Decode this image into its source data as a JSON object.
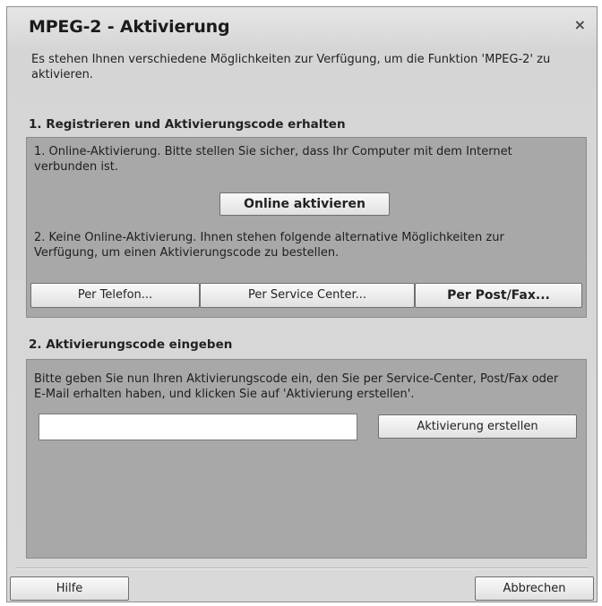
{
  "dialog": {
    "title": "MPEG-2 - Aktivierung",
    "close_glyph": "×",
    "intro": "Es stehen Ihnen verschiedene Möglichkeiten zur Verfügung, um die Funktion 'MPEG-2'  zu aktivieren."
  },
  "section1": {
    "heading": "1. Registrieren und Aktivierungscode erhalten",
    "online_text": "1. Online-Aktivierung. Bitte stellen Sie sicher, dass Ihr Computer mit dem Internet verbunden ist.",
    "online_button": "Online aktivieren",
    "offline_text": "2. Keine Online-Aktivierung. Ihnen stehen folgende alternative Möglichkeiten zur Verfügung, um einen Aktivierungscode zu bestellen.",
    "options": [
      "Per Telefon...",
      "Per Service Center...",
      "Per Post/Fax..."
    ]
  },
  "section2": {
    "heading": "2. Aktivierungscode eingeben",
    "text": "Bitte geben Sie nun Ihren Aktivierungscode ein, den Sie per Service-Center, Post/Fax oder E-Mail erhalten haben, und klicken Sie auf 'Aktivierung erstellen'.",
    "code_value": "",
    "create_button": "Aktivierung erstellen"
  },
  "footer": {
    "help_button": "Hilfe",
    "cancel_button": "Abbrechen"
  }
}
